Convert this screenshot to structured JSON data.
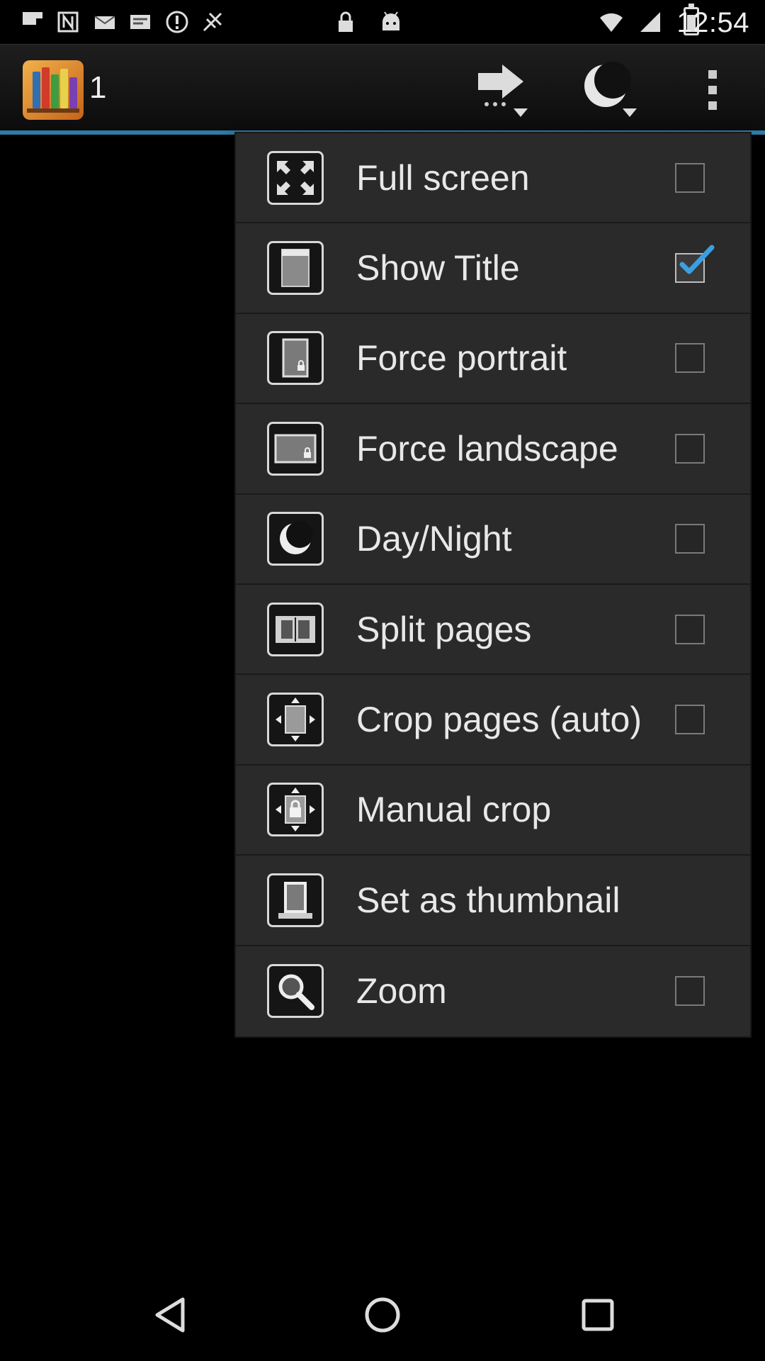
{
  "status_bar": {
    "time": "12:54",
    "icons": [
      "flipboard-icon",
      "nfc-icon",
      "mail-icon",
      "alert-icon",
      "location-icon",
      "lock-icon",
      "android-icon",
      "wifi-icon",
      "signal-icon",
      "battery-icon"
    ]
  },
  "action_bar": {
    "title": "1",
    "logo_icon": "bookshelf-icon",
    "actions": [
      "next-page-icon",
      "day-night-icon",
      "overflow-menu-icon"
    ]
  },
  "menu": {
    "items": [
      {
        "label": "Full screen",
        "icon": "fullscreen-icon",
        "has_checkbox": true,
        "checked": false
      },
      {
        "label": "Show Title",
        "icon": "show-title-icon",
        "has_checkbox": true,
        "checked": true
      },
      {
        "label": "Force portrait",
        "icon": "portrait-lock-icon",
        "has_checkbox": true,
        "checked": false
      },
      {
        "label": "Force landscape",
        "icon": "landscape-lock-icon",
        "has_checkbox": true,
        "checked": false
      },
      {
        "label": "Day/Night",
        "icon": "moon-icon",
        "has_checkbox": true,
        "checked": false
      },
      {
        "label": "Split pages",
        "icon": "split-pages-icon",
        "has_checkbox": true,
        "checked": false
      },
      {
        "label": "Crop pages (auto)",
        "icon": "auto-crop-icon",
        "has_checkbox": true,
        "checked": false
      },
      {
        "label": "Manual crop",
        "icon": "manual-crop-icon",
        "has_checkbox": false,
        "checked": false
      },
      {
        "label": "Set as thumbnail",
        "icon": "thumbnail-icon",
        "has_checkbox": false,
        "checked": false
      },
      {
        "label": "Zoom",
        "icon": "zoom-icon",
        "has_checkbox": true,
        "checked": false
      }
    ]
  },
  "nav_bar": {
    "buttons": [
      "back-icon",
      "home-icon",
      "recents-icon"
    ]
  },
  "colors": {
    "accent": "#2f7aa8",
    "check": "#3b9fe0",
    "menu_bg": "#2a2a2a"
  }
}
